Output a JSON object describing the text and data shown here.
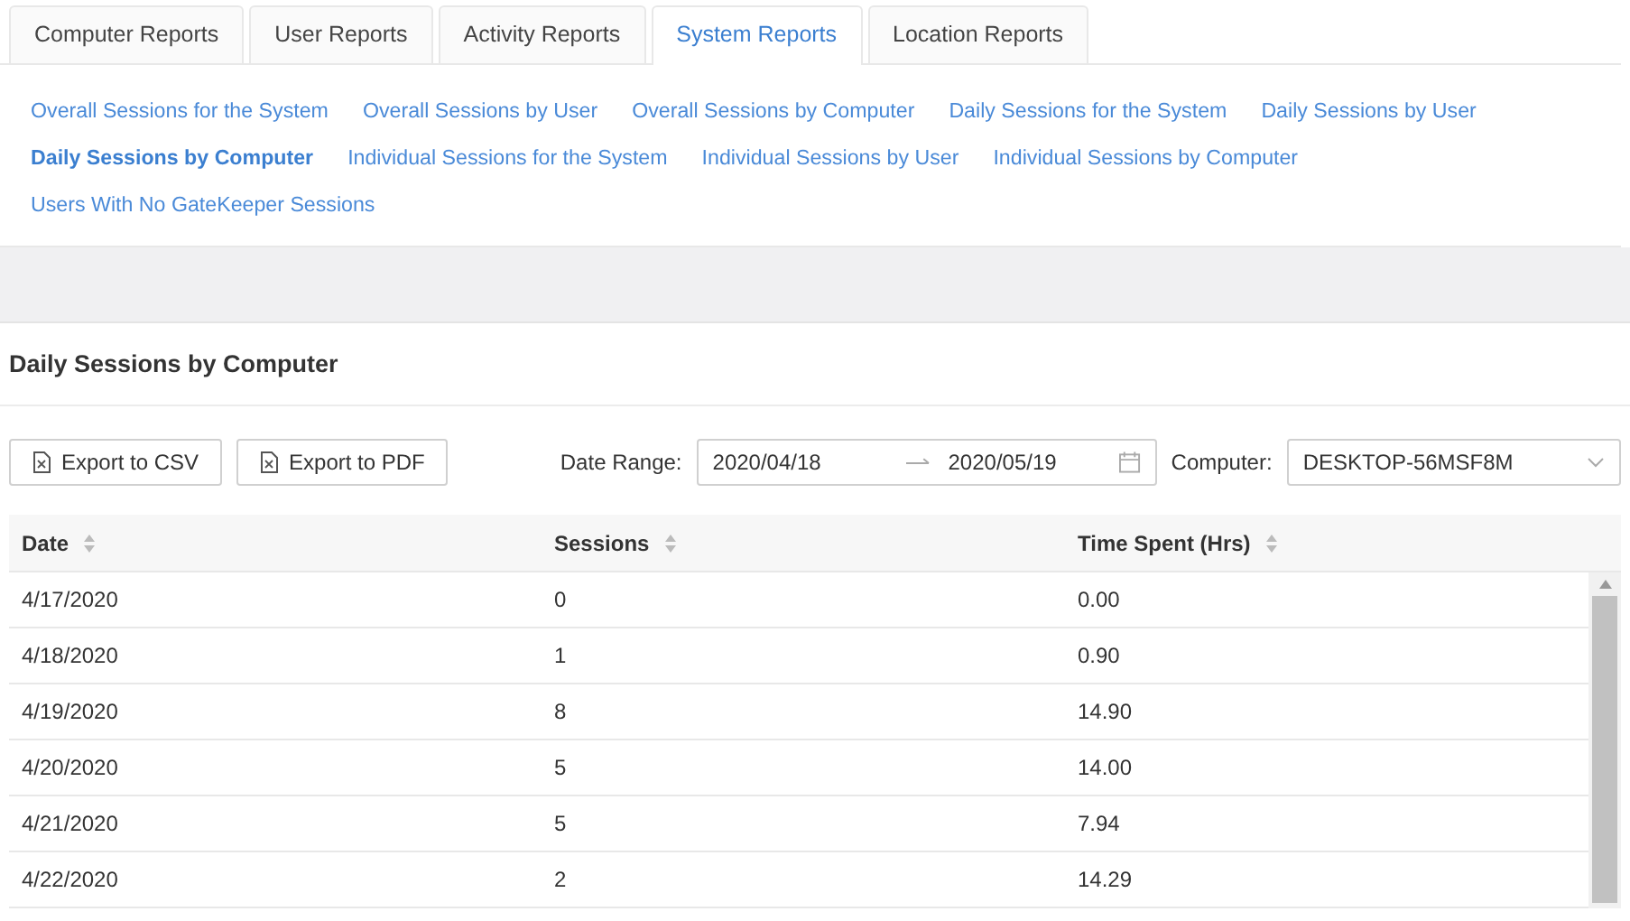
{
  "tabs": [
    {
      "label": "Computer Reports",
      "selected": false
    },
    {
      "label": "User Reports",
      "selected": false
    },
    {
      "label": "Activity Reports",
      "selected": false
    },
    {
      "label": "System Reports",
      "selected": true
    },
    {
      "label": "Location Reports",
      "selected": false
    }
  ],
  "report_links": [
    {
      "label": "Overall Sessions for the System",
      "selected": false
    },
    {
      "label": "Overall Sessions by User",
      "selected": false
    },
    {
      "label": "Overall Sessions by Computer",
      "selected": false
    },
    {
      "label": "Daily Sessions for the System",
      "selected": false
    },
    {
      "label": "Daily Sessions by User",
      "selected": false
    },
    {
      "label": "Daily Sessions by Computer",
      "selected": true
    },
    {
      "label": "Individual Sessions for the System",
      "selected": false
    },
    {
      "label": "Individual Sessions by User",
      "selected": false
    },
    {
      "label": "Individual Sessions by Computer",
      "selected": false
    },
    {
      "label": "Users With No GateKeeper Sessions",
      "selected": false
    }
  ],
  "report": {
    "title": "Daily Sessions by Computer",
    "buttons": [
      {
        "label": "Export to CSV"
      },
      {
        "label": "Export to PDF"
      }
    ],
    "date_range": {
      "label": "Date Range:",
      "start": "2020/04/18",
      "end": "2020/05/19"
    },
    "computer": {
      "label": "Computer:",
      "value": "DESKTOP-56MSF8M"
    },
    "table": {
      "columns": [
        "Date",
        "Sessions",
        "Time Spent (Hrs)"
      ],
      "rows": [
        [
          "4/17/2020",
          "0",
          "0.00"
        ],
        [
          "4/18/2020",
          "1",
          "0.90"
        ],
        [
          "4/19/2020",
          "8",
          "14.90"
        ],
        [
          "4/20/2020",
          "5",
          "14.00"
        ],
        [
          "4/21/2020",
          "5",
          "7.94"
        ],
        [
          "4/22/2020",
          "2",
          "14.29"
        ]
      ]
    }
  }
}
